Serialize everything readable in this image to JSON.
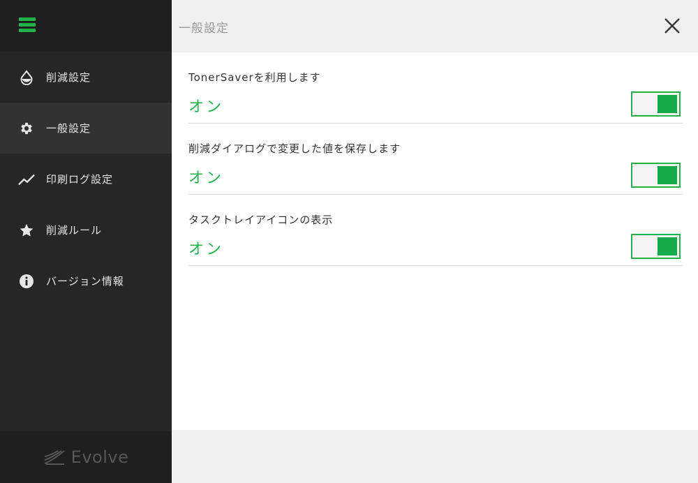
{
  "sidebar": {
    "items": [
      {
        "label": "削減設定",
        "icon": "drop-icon"
      },
      {
        "label": "一般設定",
        "icon": "gear-icon",
        "active": true
      },
      {
        "label": "印刷ログ設定",
        "icon": "trend-icon"
      },
      {
        "label": "削減ルール",
        "icon": "star-icon"
      },
      {
        "label": "バージョン情報",
        "icon": "info-icon"
      }
    ],
    "footer_logo": "Evolve"
  },
  "header": {
    "title": "一般設定"
  },
  "settings": [
    {
      "label": "TonerSaverを利用します",
      "state": "オン",
      "enabled": true
    },
    {
      "label": "削減ダイアログで変更した値を保存します",
      "state": "オン",
      "enabled": true
    },
    {
      "label": "タスクトレイアイコンの表示",
      "state": "オン",
      "enabled": true
    }
  ],
  "colors": {
    "accent": "#21b24b",
    "sidebar_bg": "#262626",
    "active_item_bg": "#323232"
  }
}
